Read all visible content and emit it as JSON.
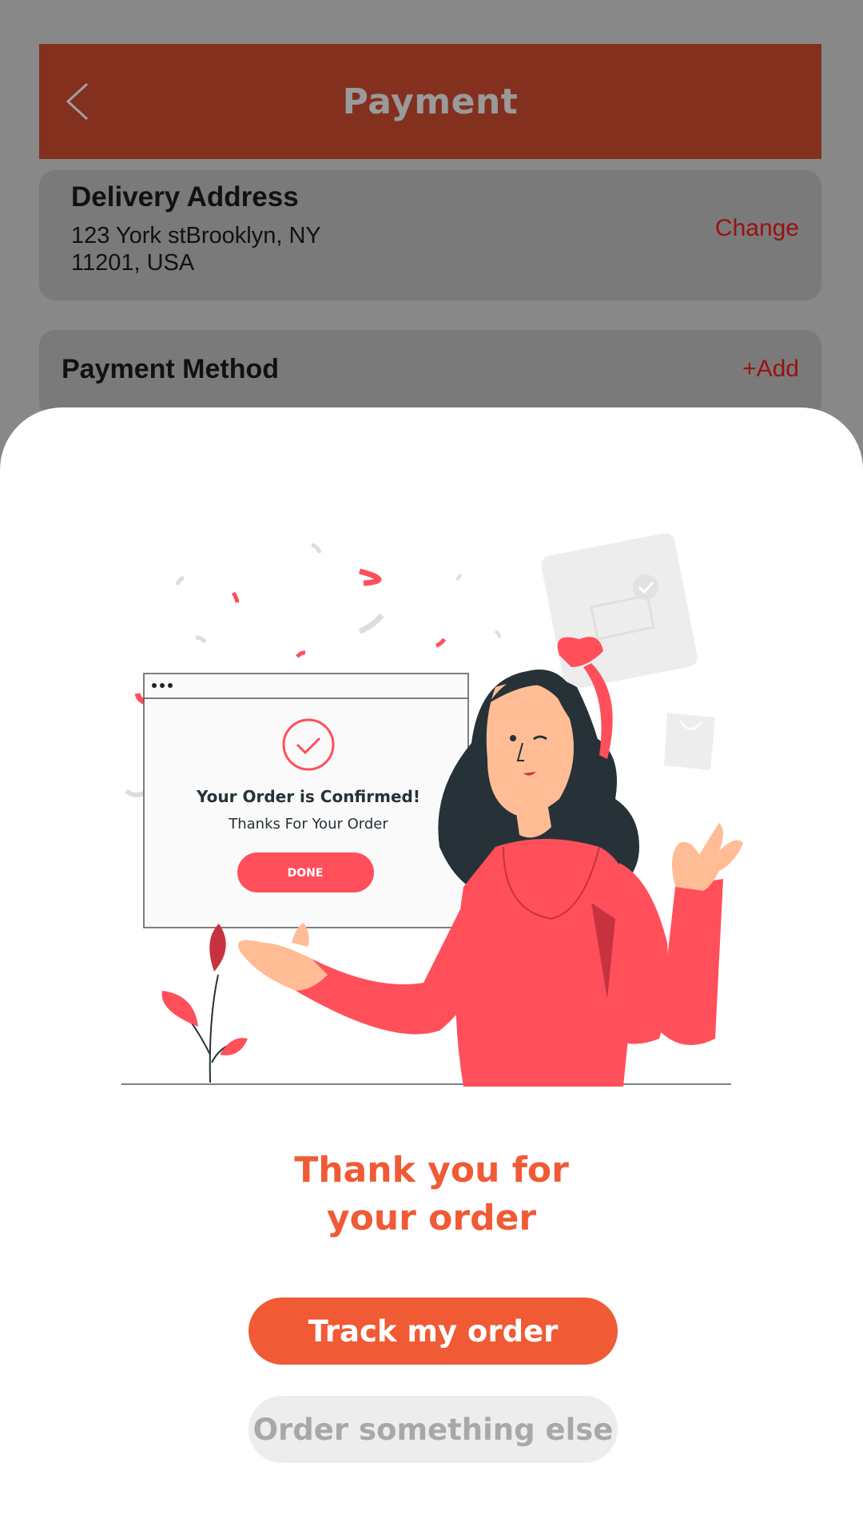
{
  "header": {
    "title": "Payment",
    "back_icon": "chevron-left-icon"
  },
  "delivery": {
    "title": "Delivery Address",
    "address_line1": "123 York stBrooklyn, NY",
    "address_line2": "11201, USA",
    "change_label": "Change"
  },
  "payment": {
    "title": "Payment Method",
    "add_label": "+Add"
  },
  "illustration": {
    "window_title": "Your Order is Confirmed!",
    "window_subtitle": "Thanks For Your Order",
    "window_button": "DONE"
  },
  "confirmation": {
    "title_line1": "Thank you for",
    "title_line2": "your order",
    "track_label": "Track my order",
    "other_label": "Order something else"
  },
  "colors": {
    "accent": "#F05A35",
    "header_bg": "#83301F",
    "link": "#9B1010",
    "illustration_red": "#FF4F5B"
  }
}
